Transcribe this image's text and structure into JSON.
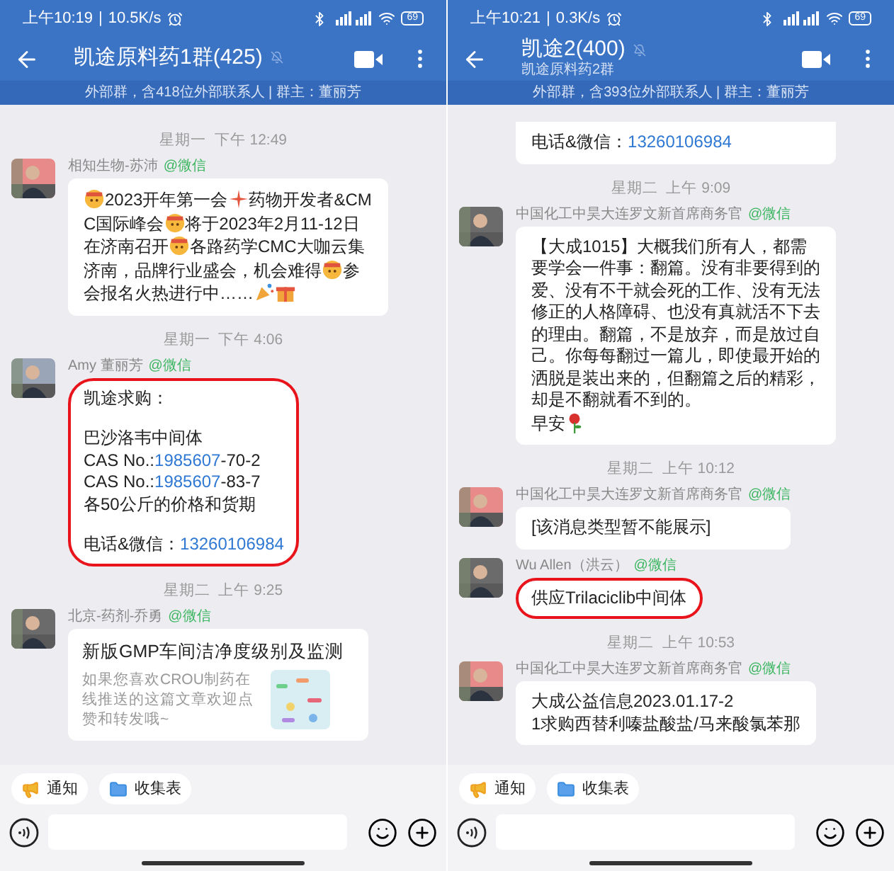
{
  "panels": [
    {
      "status": {
        "time": "上午10:19",
        "separator": "|",
        "speed": "10.5K/s",
        "battery": "69"
      },
      "header": {
        "title": "凯途原料药1群(425)"
      },
      "banner": "外部群，含418位外部联系人 | 群主：董丽芳",
      "feed": [
        {
          "kind": "time",
          "text": "星期一  下午 12:49"
        },
        {
          "kind": "message",
          "sender": "相知生物-苏沛",
          "source": "@微信",
          "highlighted": false,
          "cut": false,
          "paragraphs": [
            [
              [
                {
                  "kind": "face"
                },
                {
                  "kind": "text",
                  "t": "2023开年第一会"
                },
                {
                  "kind": "firework"
                },
                {
                  "kind": "text",
                  "t": "药物开发者&CMC国际峰会"
                },
                {
                  "kind": "face"
                },
                {
                  "kind": "text",
                  "t": "将于2023年2月11-12日在济南召开"
                },
                {
                  "kind": "face"
                },
                {
                  "kind": "text",
                  "t": "各路药学CMC大咖云集济南，品牌行业盛会，机会难得"
                },
                {
                  "kind": "face"
                },
                {
                  "kind": "text",
                  "t": "参会报名火热进行中……"
                },
                {
                  "kind": "party"
                },
                {
                  "kind": "gift"
                }
              ]
            ]
          ]
        },
        {
          "kind": "time",
          "text": "星期一  下午 4:06"
        },
        {
          "kind": "message",
          "sender": "Amy 董丽芳",
          "source": "@微信",
          "highlighted": true,
          "cut": false,
          "paragraphs": [
            [
              [
                {
                  "kind": "text",
                  "t": "凯途求购："
                }
              ]
            ],
            [
              [
                {
                  "kind": "text",
                  "t": "巴沙洛韦中间体"
                }
              ],
              [
                {
                  "kind": "text",
                  "t": "CAS No.:"
                },
                {
                  "kind": "link",
                  "t": "1985607"
                },
                {
                  "kind": "text",
                  "t": "-70-2"
                }
              ],
              [
                {
                  "kind": "text",
                  "t": "CAS No.:"
                },
                {
                  "kind": "link",
                  "t": "1985607"
                },
                {
                  "kind": "text",
                  "t": "-83-7"
                }
              ],
              [
                {
                  "kind": "text",
                  "t": "各50公斤的价格和货期"
                }
              ]
            ],
            [
              [
                {
                  "kind": "text",
                  "t": "电话&微信："
                },
                {
                  "kind": "link",
                  "t": "13260106984"
                }
              ]
            ]
          ]
        },
        {
          "kind": "time",
          "text": "星期二  上午 9:25"
        },
        {
          "kind": "article",
          "sender": "北京-药剂-乔勇",
          "source": "@微信",
          "title": "新版GMP车间洁净度级别及监测",
          "summary": "如果您喜欢CROU制药在线推送的这篇文章欢迎点赞和转发哦~"
        }
      ],
      "chips": [
        "通知",
        "收集表"
      ]
    },
    {
      "status": {
        "time": "上午10:21",
        "separator": "|",
        "speed": "0.3K/s",
        "battery": "69"
      },
      "header": {
        "title": "凯途2(400)",
        "subtitle": "凯途原料药2群"
      },
      "banner": "外部群，含393位外部联系人 | 群主：董丽芳",
      "feed": [
        {
          "kind": "message",
          "highlighted": false,
          "cut": true,
          "paragraphs": [
            [
              [
                {
                  "kind": "text",
                  "t": "电话&微信："
                },
                {
                  "kind": "link",
                  "t": "13260106984"
                }
              ]
            ]
          ]
        },
        {
          "kind": "time",
          "text": "星期二  上午 9:09"
        },
        {
          "kind": "message",
          "sender": "中国化工中昊大连罗文新首席商务官",
          "source": "@微信",
          "highlighted": false,
          "cut": false,
          "paragraphs": [
            [
              [
                {
                  "kind": "text",
                  "t": "【大成1015】大概我们所有人，都需要学会一件事：翻篇。没有非要得到的爱、没有不干就会死的工作、没有无法修正的人格障碍、也没有真就活不下去的理由。翻篇，不是放弃，而是放过自己。你每每翻过一篇儿，即使最开始的洒脱是装出来的，但翻篇之后的精彩，却是不翻就看不到的。"
                }
              ],
              [
                {
                  "kind": "text",
                  "t": "早安"
                },
                {
                  "kind": "rose"
                }
              ]
            ]
          ]
        },
        {
          "kind": "time",
          "text": "星期二  上午 10:12"
        },
        {
          "kind": "message",
          "sender": "中国化工中昊大连罗文新首席商务官",
          "source": "@微信",
          "highlighted": false,
          "cut": false,
          "paragraphs": [
            [
              [
                {
                  "kind": "text",
                  "t": "[该消息类型暂不能展示]"
                }
              ]
            ]
          ]
        },
        {
          "kind": "message",
          "sender": "Wu Allen（洪云）",
          "source": "@微信",
          "highlighted": true,
          "cut": false,
          "paragraphs": [
            [
              [
                {
                  "kind": "text",
                  "t": "供应Trilaciclib中间体"
                }
              ]
            ]
          ]
        },
        {
          "kind": "time",
          "text": "星期二  上午 10:53"
        },
        {
          "kind": "message",
          "sender": "中国化工中昊大连罗文新首席商务官",
          "source": "@微信",
          "highlighted": false,
          "cut": false,
          "paragraphs": [
            [
              [
                {
                  "kind": "text",
                  "t": "大成公益信息2023.01.17-2"
                }
              ],
              [
                {
                  "kind": "text",
                  "t": "1求购西替利嗪盐酸盐/马来酸氯苯那"
                }
              ]
            ]
          ]
        }
      ],
      "chips": [
        "通知",
        "收集表"
      ]
    }
  ]
}
